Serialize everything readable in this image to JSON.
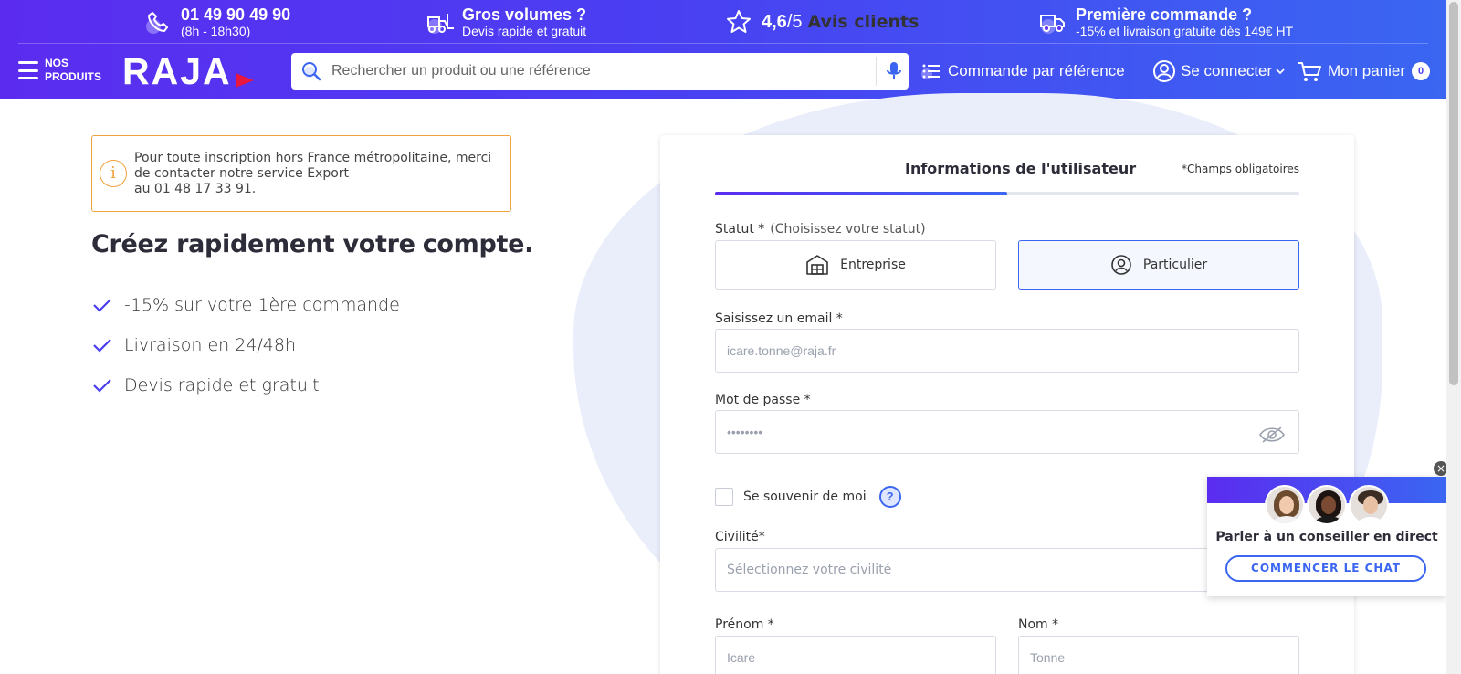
{
  "header": {
    "phone": {
      "number": "01 49 90 49 90",
      "hours": "(8h - 18h30)",
      "icon": "phone-icon"
    },
    "volumes": {
      "title": "Gros volumes ?",
      "subtitle": "Devis rapide et gratuit",
      "icon": "forklift-icon"
    },
    "rating": {
      "score": "4,6",
      "max": "/5",
      "label": "Avis clients",
      "icon": "star-icon"
    },
    "first_order": {
      "title": "Première commande ?",
      "subtitle": "-15% et livraison gratuite dès 149€ HT",
      "icon": "delivery-truck-icon"
    },
    "menu": {
      "line1": "NOS",
      "line2": "PRODUITS"
    },
    "logo": "RAJA",
    "search": {
      "placeholder": "Rechercher un produit ou une référence"
    },
    "order_by_ref": "Commande par référence",
    "login": "Se connecter",
    "cart": {
      "label": "Mon panier",
      "count": "0"
    },
    "colors": {
      "gradient_start": "#5b2cf0",
      "gradient_end": "#3a66f2",
      "logo_accent": "#e8173f"
    }
  },
  "left": {
    "notice": {
      "line1": "Pour toute inscription hors France métropolitaine, merci",
      "line2": "de contacter notre service Export",
      "line3": "au 01 48 17 33 91."
    },
    "hero": {
      "part1": "Créez rapidement votre",
      "highlight": "compte."
    },
    "benefits": [
      "-15% sur votre 1ère commande",
      "Livraison en 24/48h",
      "Devis rapide et gratuit"
    ]
  },
  "form": {
    "step_title": "Informations de l'utilisateur",
    "required_note": "*Champs obligatoires",
    "progress_fraction": 0.5,
    "status": {
      "label": "Statut *",
      "hint": "(Choisissez votre statut)",
      "options": [
        "Entreprise",
        "Particulier"
      ],
      "selected": "Particulier"
    },
    "email": {
      "label": "Saisissez un email *",
      "placeholder": "icare.tonne@raja.fr"
    },
    "password": {
      "label": "Mot de passe *",
      "placeholder": "••••••••"
    },
    "remember": {
      "label": "Se souvenir de moi"
    },
    "civility": {
      "label": "Civilité*",
      "placeholder": "Sélectionnez votre civilité"
    },
    "firstname": {
      "label": "Prénom *",
      "placeholder": "Icare"
    },
    "lastname": {
      "label": "Nom *",
      "placeholder": "Tonne"
    }
  },
  "chat": {
    "title": "Parler à un conseiller en direct",
    "button": "COMMENCER LE CHAT",
    "close": "×"
  }
}
